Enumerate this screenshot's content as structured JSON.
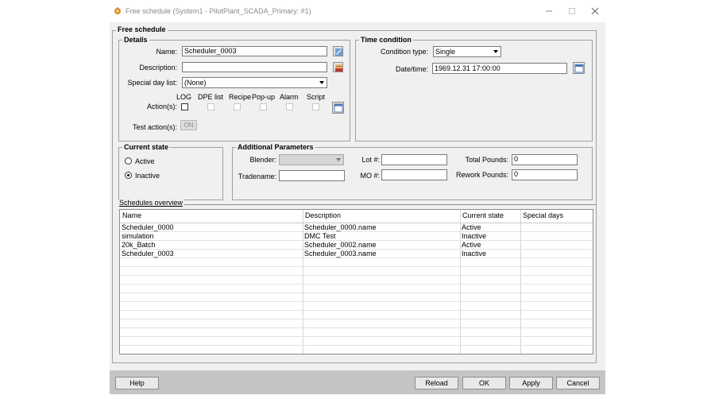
{
  "window": {
    "title": "Free schedule (System1 - PilotPlant_SCADA_Primary: #1)"
  },
  "free_schedule": {
    "legend": "Free schedule"
  },
  "details": {
    "legend": "Details",
    "name_label": "Name:",
    "name_value": "Scheduler_0003",
    "description_label": "Description:",
    "description_value": "",
    "special_day_label": "Special day list:",
    "special_day_value": "(None)",
    "actions_label": "Action(s):",
    "action_columns": [
      "LOG",
      "DPE list",
      "Recipe",
      "Pop-up",
      "Alarm",
      "Script"
    ],
    "test_actions_label": "Test action(s):",
    "test_button_label": "ON"
  },
  "time_condition": {
    "legend": "Time condition",
    "condition_type_label": "Condition type:",
    "condition_type_value": "Single",
    "datetime_label": "Date/time:",
    "datetime_value": "1969.12.31 17:00:00"
  },
  "current_state": {
    "legend": "Current state",
    "active_label": "Active",
    "inactive_label": "Inactive",
    "selected": "Inactive"
  },
  "additional": {
    "legend": "Additional Parameters",
    "blender_label": "Blender:",
    "blender_value": "",
    "tradename_label": "Tradename:",
    "tradename_value": "",
    "lot_label": "Lot #:",
    "lot_value": "",
    "mo_label": "MO #:",
    "mo_value": "",
    "total_pounds_label": "Total Pounds:",
    "total_pounds_value": "0",
    "rework_pounds_label": "Rework Pounds:",
    "rework_pounds_value": "0"
  },
  "overview": {
    "label": "Schedules overview",
    "columns": [
      "Name",
      "Description",
      "Current state",
      "Special days"
    ],
    "rows": [
      {
        "name": "Scheduler_0000",
        "description": "Scheduler_0000.name",
        "state": "Active",
        "special": ""
      },
      {
        "name": "simulation",
        "description": "DMC Test",
        "state": "Inactive",
        "special": ""
      },
      {
        "name": "20k_Batch",
        "description": "Scheduler_0002.name",
        "state": "Active",
        "special": ""
      },
      {
        "name": "Scheduler_0003",
        "description": "Scheduler_0003.name",
        "state": "Inactive",
        "special": ""
      }
    ]
  },
  "buttons": {
    "help": "Help",
    "reload": "Reload",
    "ok": "OK",
    "apply": "Apply",
    "cancel": "Cancel"
  },
  "icons": {
    "app": "gear-app-icon",
    "name_edit": "edit-icon",
    "description_edit": "translate-icon",
    "actions_config": "window-icon",
    "calendar": "calendar-icon"
  },
  "colors": {
    "dialog_bg": "#f0f0f0",
    "bottom_bar": "#c4c4c4",
    "frame_border": "#a0a0a0"
  }
}
